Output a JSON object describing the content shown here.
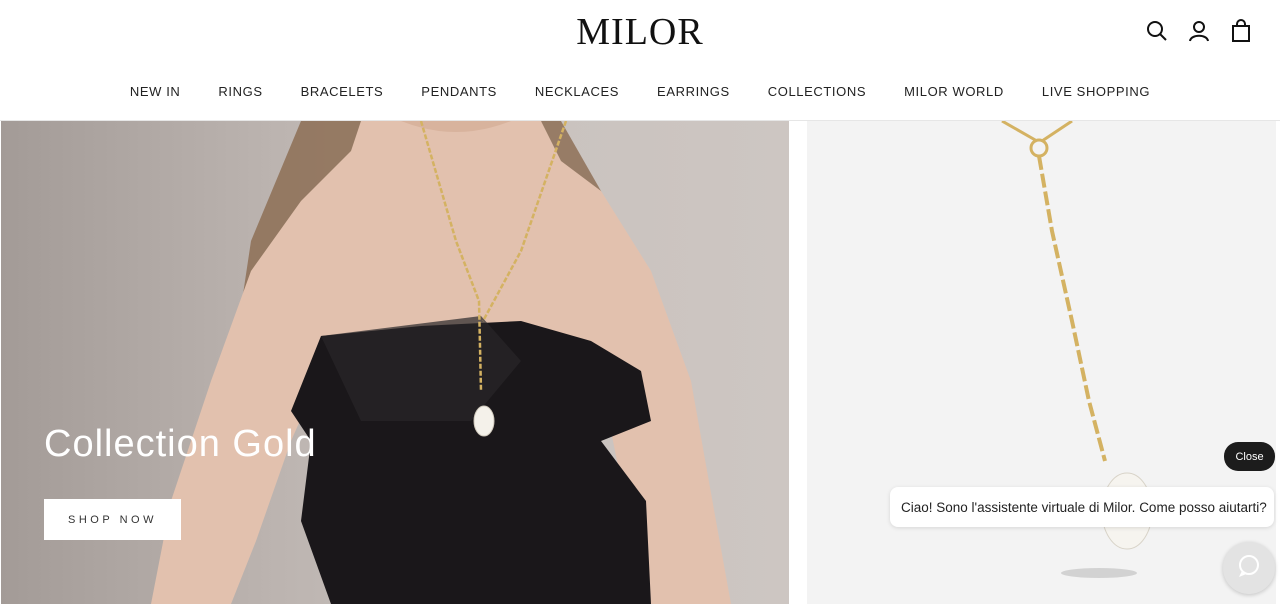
{
  "brand": {
    "logo": "MILOR"
  },
  "header": {
    "icons": [
      "search-icon",
      "account-icon",
      "cart-icon"
    ]
  },
  "nav": {
    "items": [
      {
        "label": "NEW IN"
      },
      {
        "label": "RINGS"
      },
      {
        "label": "BRACELETS"
      },
      {
        "label": "PENDANTS"
      },
      {
        "label": "NECKLACES"
      },
      {
        "label": "EARRINGS"
      },
      {
        "label": "COLLECTIONS"
      },
      {
        "label": "MILOR WORLD"
      },
      {
        "label": "LIVE SHOPPING"
      }
    ]
  },
  "hero": {
    "title": "Collection Gold",
    "cta_label": "SHOP NOW"
  },
  "chat": {
    "close_label": "Close",
    "message": "Ciao! Sono l'assistente virtuale di Milor. Come posso aiutarti?",
    "launcher_icon": "chat-icon"
  },
  "colors": {
    "dark": "#1c1c1c",
    "accent_gold": "#d4b262",
    "hero_bg": "#c4bcb8",
    "product_bg": "#f3f3f3"
  }
}
